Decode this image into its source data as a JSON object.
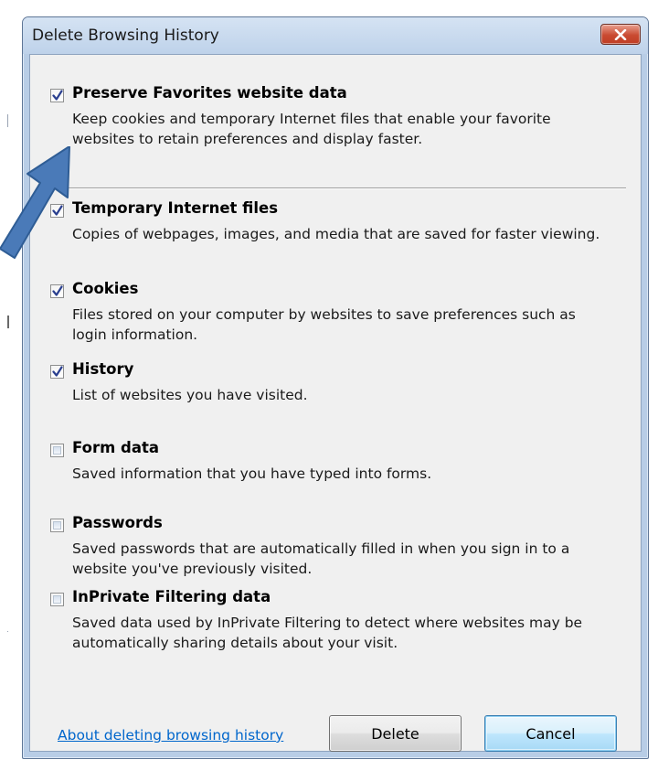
{
  "window": {
    "title": "Delete Browsing History"
  },
  "items": [
    {
      "id": "preserve-favorites",
      "label": "Preserve Favorites website data",
      "checked": true,
      "description": "Keep cookies and temporary Internet files that enable your favorite websites to retain preferences and display faster."
    },
    {
      "id": "temporary-internet-files",
      "label": "Temporary Internet files",
      "checked": true,
      "description": "Copies of webpages, images, and media that are saved for faster viewing."
    },
    {
      "id": "cookies",
      "label": "Cookies",
      "checked": true,
      "description": "Files stored on your computer by websites to save preferences such as login information."
    },
    {
      "id": "history",
      "label": "History",
      "checked": true,
      "description": "List of websites you have visited."
    },
    {
      "id": "form-data",
      "label": "Form data",
      "checked": false,
      "description": "Saved information that you have typed into forms."
    },
    {
      "id": "passwords",
      "label": "Passwords",
      "checked": false,
      "description": "Saved passwords that are automatically filled in when you sign in to a website you've previously visited."
    },
    {
      "id": "inprivate-filtering",
      "label": "InPrivate Filtering data",
      "checked": false,
      "description": "Saved data used by InPrivate Filtering to detect where websites may be automatically sharing details about your visit."
    }
  ],
  "footer": {
    "link_label": "About deleting browsing history",
    "delete_label": "Delete",
    "cancel_label": "Cancel"
  },
  "colors": {
    "link": "#0066cc",
    "arrow": "#4a7ab8",
    "close_button": "#c94a31"
  }
}
